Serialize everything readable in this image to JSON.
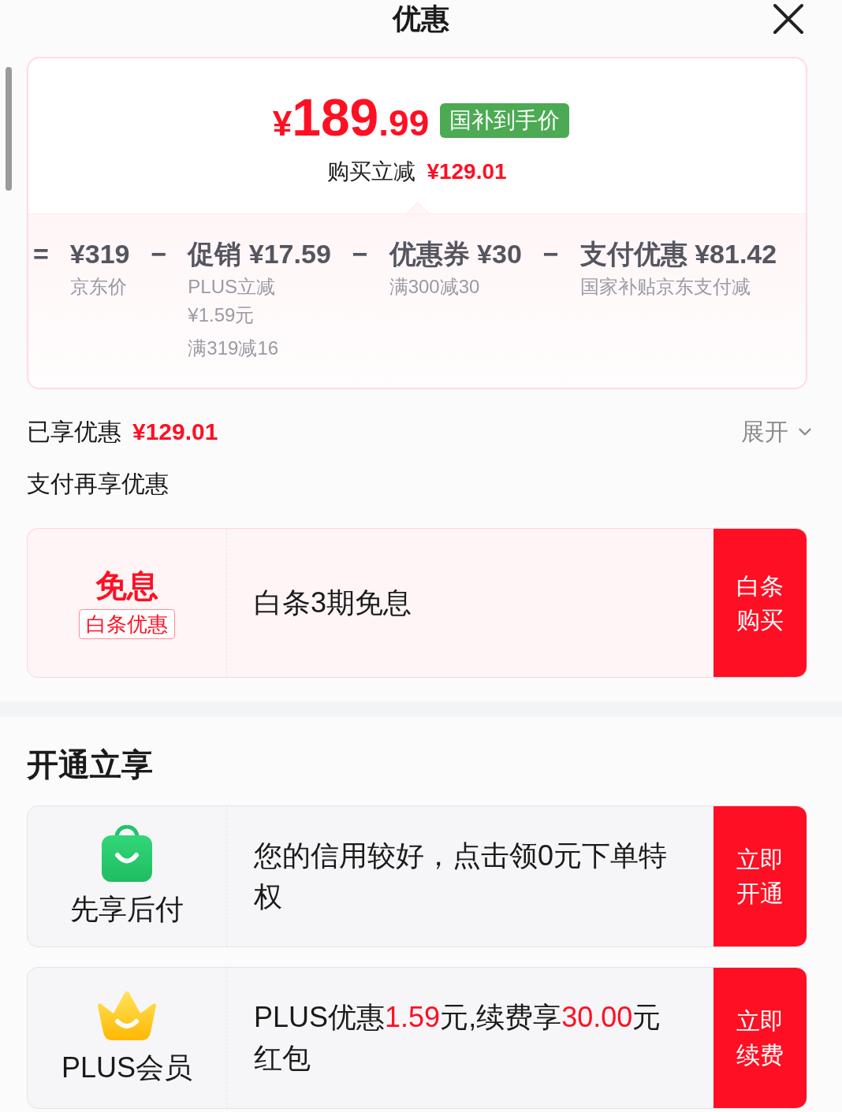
{
  "header": {
    "title": "优惠"
  },
  "price_card": {
    "price": {
      "currency": "¥",
      "integer": "189",
      "decimal": ".99"
    },
    "badge": "国补到手价",
    "saving": {
      "label": "购买立减",
      "amount": "¥129.01"
    },
    "breakdown": [
      {
        "operator": "=",
        "title": "¥319",
        "notes": [
          "京东价"
        ]
      },
      {
        "operator": "−",
        "title": "促销 ¥17.59",
        "notes": [
          "PLUS立减 ¥1.59元",
          "满319减16"
        ]
      },
      {
        "operator": "−",
        "title": "优惠券 ¥30",
        "notes": [
          "满300减30"
        ]
      },
      {
        "operator": "−",
        "title": "支付优惠 ¥81.42",
        "notes": [
          "国家补贴京东支付减"
        ]
      }
    ]
  },
  "enjoyed": {
    "label": "已享优惠",
    "amount": "¥129.01",
    "toggle": {
      "label": "展开",
      "expanded": false
    }
  },
  "pay_offers": {
    "title": "支付再享优惠",
    "items": [
      {
        "kind": "tag",
        "headline": "免息",
        "tag": "白条优惠",
        "text": "白条3期免息",
        "action": "白条购买"
      }
    ]
  },
  "open_offers": {
    "title": "开通立享",
    "items": [
      {
        "kind": "paylater",
        "label": "先享后付",
        "text": "您的信用较好，点击领0元下单特权",
        "action": "立即开通"
      },
      {
        "kind": "membership",
        "label": "PLUS会员",
        "text": "PLUS优惠**1.59**元,续费享**30.00**元红包",
        "action": "立即续费"
      }
    ]
  }
}
